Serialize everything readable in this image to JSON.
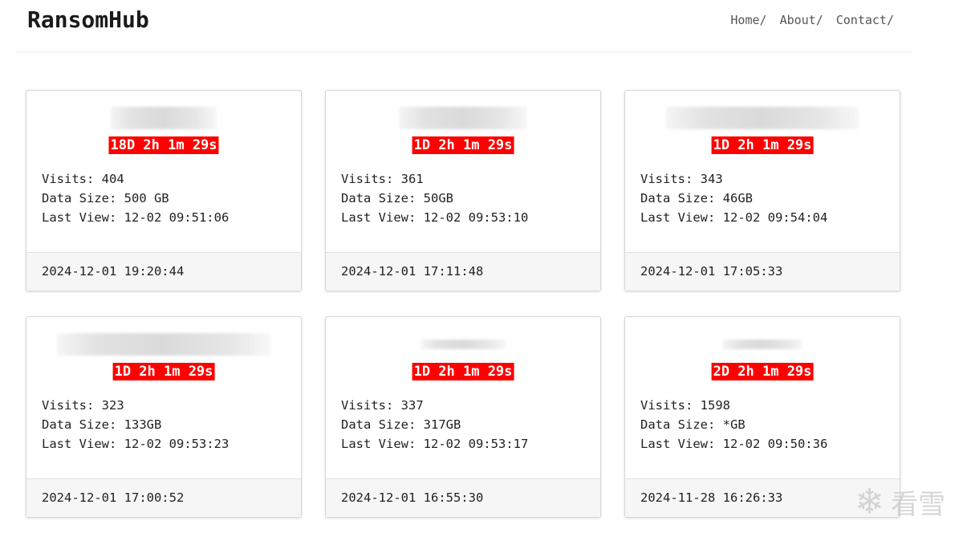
{
  "header": {
    "brand": "RansomHub",
    "nav": [
      "Home/",
      "About/",
      "Contact/"
    ]
  },
  "cards": [
    {
      "timer": "18D 2h 1m 29s",
      "visits": "Visits: 404",
      "size": "Data Size: 500 GB",
      "last_view": "Last View: 12-02 09:51:06",
      "date": "2024-12-01 19:20:44"
    },
    {
      "timer": "1D 2h 1m 29s",
      "visits": "Visits: 361",
      "size": "Data Size: 50GB",
      "last_view": "Last View: 12-02 09:53:10",
      "date": "2024-12-01 17:11:48"
    },
    {
      "timer": "1D 2h 1m 29s",
      "visits": "Visits: 343",
      "size": "Data Size: 46GB",
      "last_view": "Last View: 12-02 09:54:04",
      "date": "2024-12-01 17:05:33"
    },
    {
      "timer": "1D 2h 1m 29s",
      "visits": "Visits: 323",
      "size": "Data Size: 133GB",
      "last_view": "Last View: 12-02 09:53:23",
      "date": "2024-12-01 17:00:52"
    },
    {
      "timer": "1D 2h 1m 29s",
      "visits": "Visits: 337",
      "size": "Data Size: 317GB",
      "last_view": "Last View: 12-02 09:53:17",
      "date": "2024-12-01 16:55:30"
    },
    {
      "timer": "2D 2h 1m 29s",
      "visits": "Visits: 1598",
      "size": "Data Size: *GB",
      "last_view": "Last View: 12-02 09:50:36",
      "date": "2024-11-28 16:26:33"
    }
  ],
  "watermark": {
    "text": "看雪",
    "icon": "snowflake-icon"
  }
}
